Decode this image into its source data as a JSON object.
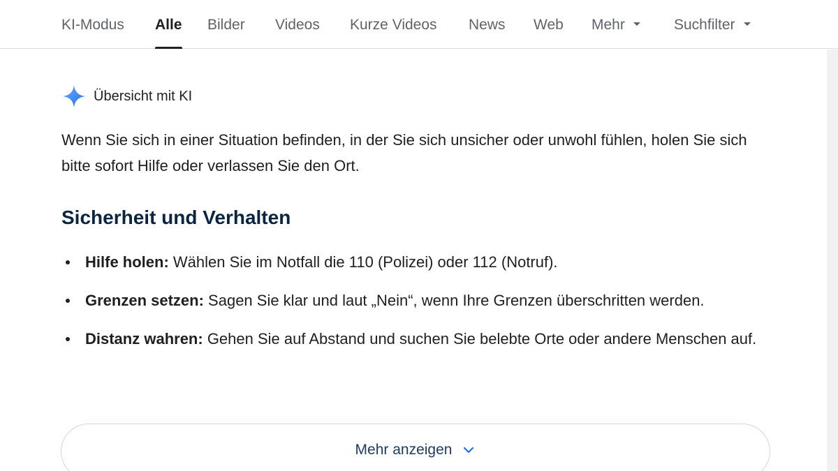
{
  "tabs": [
    {
      "label": "KI-Modus"
    },
    {
      "label": "Alle"
    },
    {
      "label": "Bilder"
    },
    {
      "label": "Videos"
    },
    {
      "label": "Kurze Videos"
    },
    {
      "label": "News"
    },
    {
      "label": "Web"
    },
    {
      "label": "Mehr"
    },
    {
      "label": "Suchfilter"
    }
  ],
  "active_tab": "Alle",
  "ai_overview": {
    "title": "Übersicht mit KI",
    "icon": "sparkle-icon",
    "intro": "Wenn Sie sich in einer Situation befinden, in der Sie sich unsicher oder unwohl fühlen, holen Sie sich bitte sofort Hilfe oder verlassen Sie den Ort.",
    "section_title": "Sicherheit und Verhalten",
    "bullets": [
      {
        "bold": "Hilfe holen:",
        "text": " Wählen Sie im Notfall die 110 (Polizei) oder 112 (Notruf)."
      },
      {
        "bold": "Grenzen setzen:",
        "text": " Sagen Sie klar und laut „Nein“, wenn Ihre Grenzen überschritten werden."
      },
      {
        "bold": "Distanz wahren:",
        "text": " Gehen Sie auf Abstand und suchen Sie belebte Orte oder andere Menschen auf."
      }
    ]
  },
  "show_more": {
    "label": "Mehr anzeigen",
    "icon": "chevron-down-icon"
  },
  "colors": {
    "sparkle": "#4285f4",
    "heading": "#0b2540",
    "text": "#1f1f1f",
    "tab_inactive": "#5f6368",
    "button_border": "#c9d7ea"
  }
}
